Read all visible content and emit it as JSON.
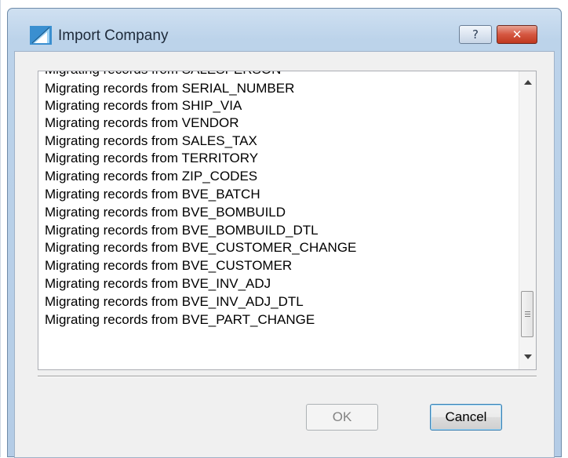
{
  "window": {
    "title": "Import Company",
    "help_label": "?",
    "close_label": "✕"
  },
  "log": {
    "partial_top_line": "Migrating records from SALESPERSON",
    "lines": [
      "Migrating records from SERIAL_NUMBER",
      "Migrating records from SHIP_VIA",
      "Migrating records from VENDOR",
      "Migrating records from SALES_TAX",
      "Migrating records from TERRITORY",
      "Migrating records from ZIP_CODES",
      "Migrating records from BVE_BATCH",
      "Migrating records from BVE_BOMBUILD",
      "Migrating records from BVE_BOMBUILD_DTL",
      "Migrating records from BVE_CUSTOMER_CHANGE",
      "Migrating records from BVE_CUSTOMER",
      "Migrating records from BVE_INV_ADJ",
      "Migrating records from BVE_INV_ADJ_DTL",
      "Migrating records from BVE_PART_CHANGE"
    ]
  },
  "buttons": {
    "ok_label": "OK",
    "ok_enabled": false,
    "cancel_label": "Cancel"
  },
  "icons": {
    "app": "import-company-app-icon",
    "help": "question-mark-icon",
    "close": "close-x-icon"
  },
  "colors": {
    "title_bar": "#bcd3ea",
    "close_button": "#c7432a",
    "default_button_border": "#3c7fb1"
  }
}
